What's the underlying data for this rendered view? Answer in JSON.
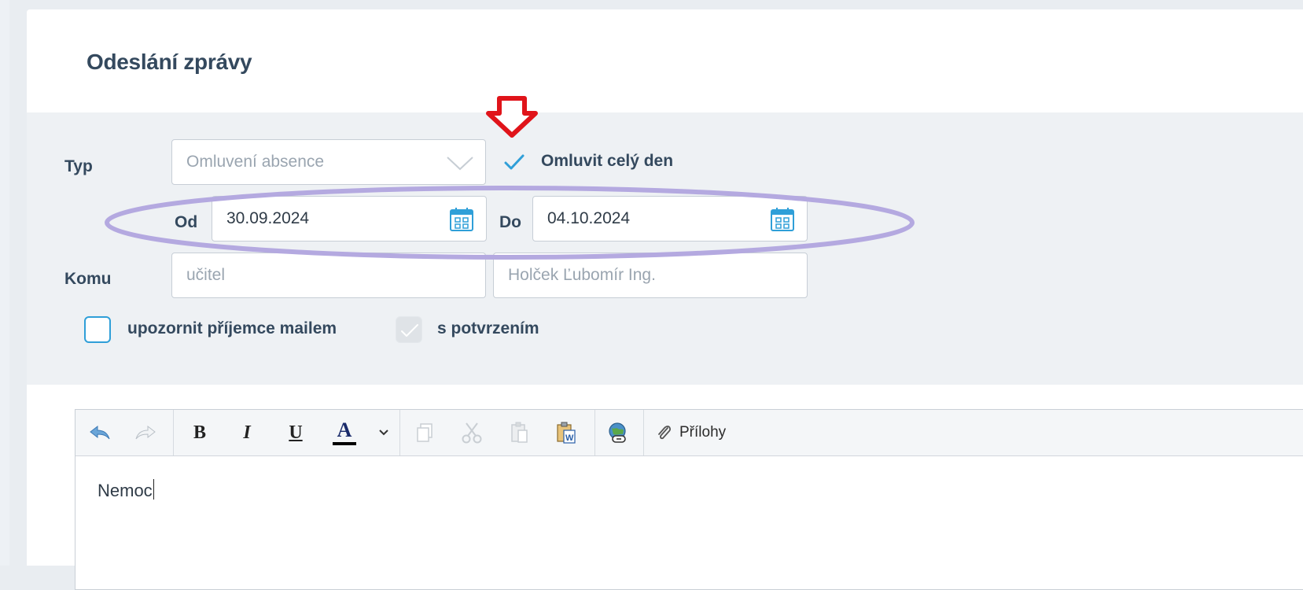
{
  "page": {
    "title": "Odeslání zprávy"
  },
  "form": {
    "type": {
      "label": "Typ",
      "value": "Omluvení absence"
    },
    "full_day": {
      "label": "Omluvit celý den",
      "checked": true
    },
    "from": {
      "label": "Od",
      "value": "30.09.2024"
    },
    "to": {
      "label": "Do",
      "value": "04.10.2024"
    },
    "recipient": {
      "label": "Komu",
      "role": "učitel",
      "name": "Holček Ľubomír Ing."
    },
    "notify_email": {
      "label": "upozornit příjemce mailem",
      "checked": false
    },
    "confirmation": {
      "label": "s potvrzením",
      "checked": true,
      "disabled": true
    }
  },
  "editor": {
    "toolbar": {
      "undo": "undo-icon",
      "redo": "redo-icon",
      "bold": "B",
      "italic": "I",
      "underline": "U",
      "font_color": "A",
      "attachments_label": "Přílohy"
    },
    "content": "Nemoc"
  },
  "colors": {
    "accent": "#2f9fd8",
    "annotation_arrow": "#e0141a",
    "annotation_ellipse": "#b4a9e0"
  }
}
